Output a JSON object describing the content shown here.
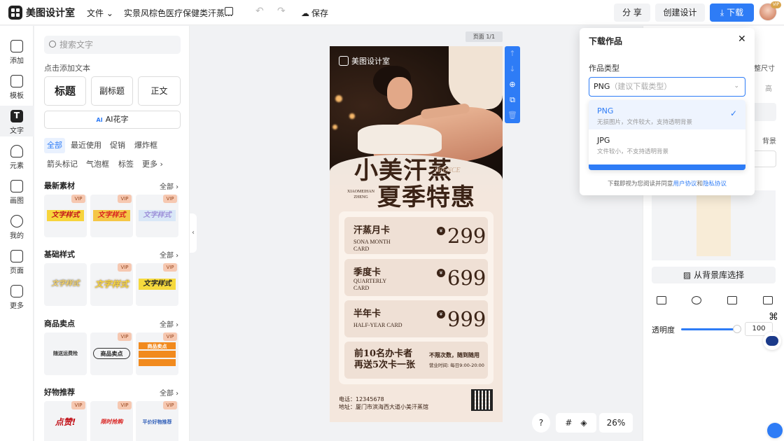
{
  "header": {
    "app_name": "美图设计室",
    "file_menu": "文件",
    "doc_title": "实景风棕色医疗保健类汗蒸...",
    "save": "保存",
    "share": "分 享",
    "create": "创建设计",
    "download": "下载",
    "vip_badge": "VIP"
  },
  "rail": {
    "items": [
      "添加",
      "模板",
      "文字",
      "元素",
      "画图",
      "我的",
      "页面",
      "更多"
    ],
    "active_icon": "T"
  },
  "panel": {
    "search_placeholder": "搜索文字",
    "click_add": "点击添加文本",
    "title_btn": "标题",
    "subtitle_btn": "副标题",
    "body_btn": "正文",
    "ai_badge": "AI",
    "ai_btn": "AI花字",
    "chips": [
      "全部",
      "最近使用",
      "促销",
      "爆炸框",
      "箭头标记",
      "气泡框",
      "标签",
      "更多"
    ],
    "sections": [
      {
        "title": "最新素材",
        "all": "全部"
      },
      {
        "title": "基础样式",
        "all": "全部"
      },
      {
        "title": "商品卖点",
        "all": "全部"
      },
      {
        "title": "好物推荐",
        "all": "全部"
      }
    ],
    "vip": "VIP",
    "tiles": [
      "文字样式",
      "文字样式",
      "文字样式",
      "文字样式",
      "文字样式",
      "文字样式",
      "随送运费险",
      "商品卖点",
      "商品卖点",
      "点赞!",
      "限时抢购",
      "平价好物推荐"
    ]
  },
  "canvas": {
    "page_badge": "页面 1/1",
    "poster_brand": "美图设计室",
    "title_line1": "小美汗蒸",
    "title_en": "SPENCE",
    "title_line2": "夏季特惠",
    "pinyin1": "XIAOMEIHAN",
    "pinyin2": "ZHENG",
    "cards": [
      {
        "cn": "汗蒸月卡",
        "en": "SONA MONTH CARD",
        "price": "299"
      },
      {
        "cn": "季度卡",
        "en": "QUARTERLY CARD",
        "price": "699"
      },
      {
        "cn": "半年卡",
        "en": "HALF-YEAR CARD",
        "price": "999"
      }
    ],
    "yen": "¥",
    "promo_line1": "前10名办卡者",
    "promo_line2": "再送5次卡一张",
    "promo_right1": "不限次数，随到随用",
    "promo_right2": "营业时间: 每日9:00-20:00",
    "phone": "电话：12345678",
    "address": "地址：厦门市滨海西大道小美汗蒸馆"
  },
  "zoom": {
    "help": "?",
    "value": "26%"
  },
  "right_panel": {
    "size_text": "整尺寸",
    "high_text": "高",
    "bg_text": "背景",
    "bg_library": "从背景库选择",
    "opacity_label": "透明度",
    "opacity_value": "100"
  },
  "download_dialog": {
    "title": "下载作品",
    "type_label": "作品类型",
    "selected": "PNG",
    "selected_hint": "（建议下载类型）",
    "options": [
      {
        "name": "PNG",
        "desc": "无损图片，文件较大，支持透明背景"
      },
      {
        "name": "JPG",
        "desc": "文件较小，不支持透明背景"
      }
    ],
    "footer_prefix": "下载即视为您阅读并同意",
    "footer_link1": "用户协议",
    "footer_and": "和",
    "footer_link2": "隐私协议"
  },
  "colors": {
    "accent": "#2e7cf6",
    "poster_brown": "#3b2316"
  }
}
